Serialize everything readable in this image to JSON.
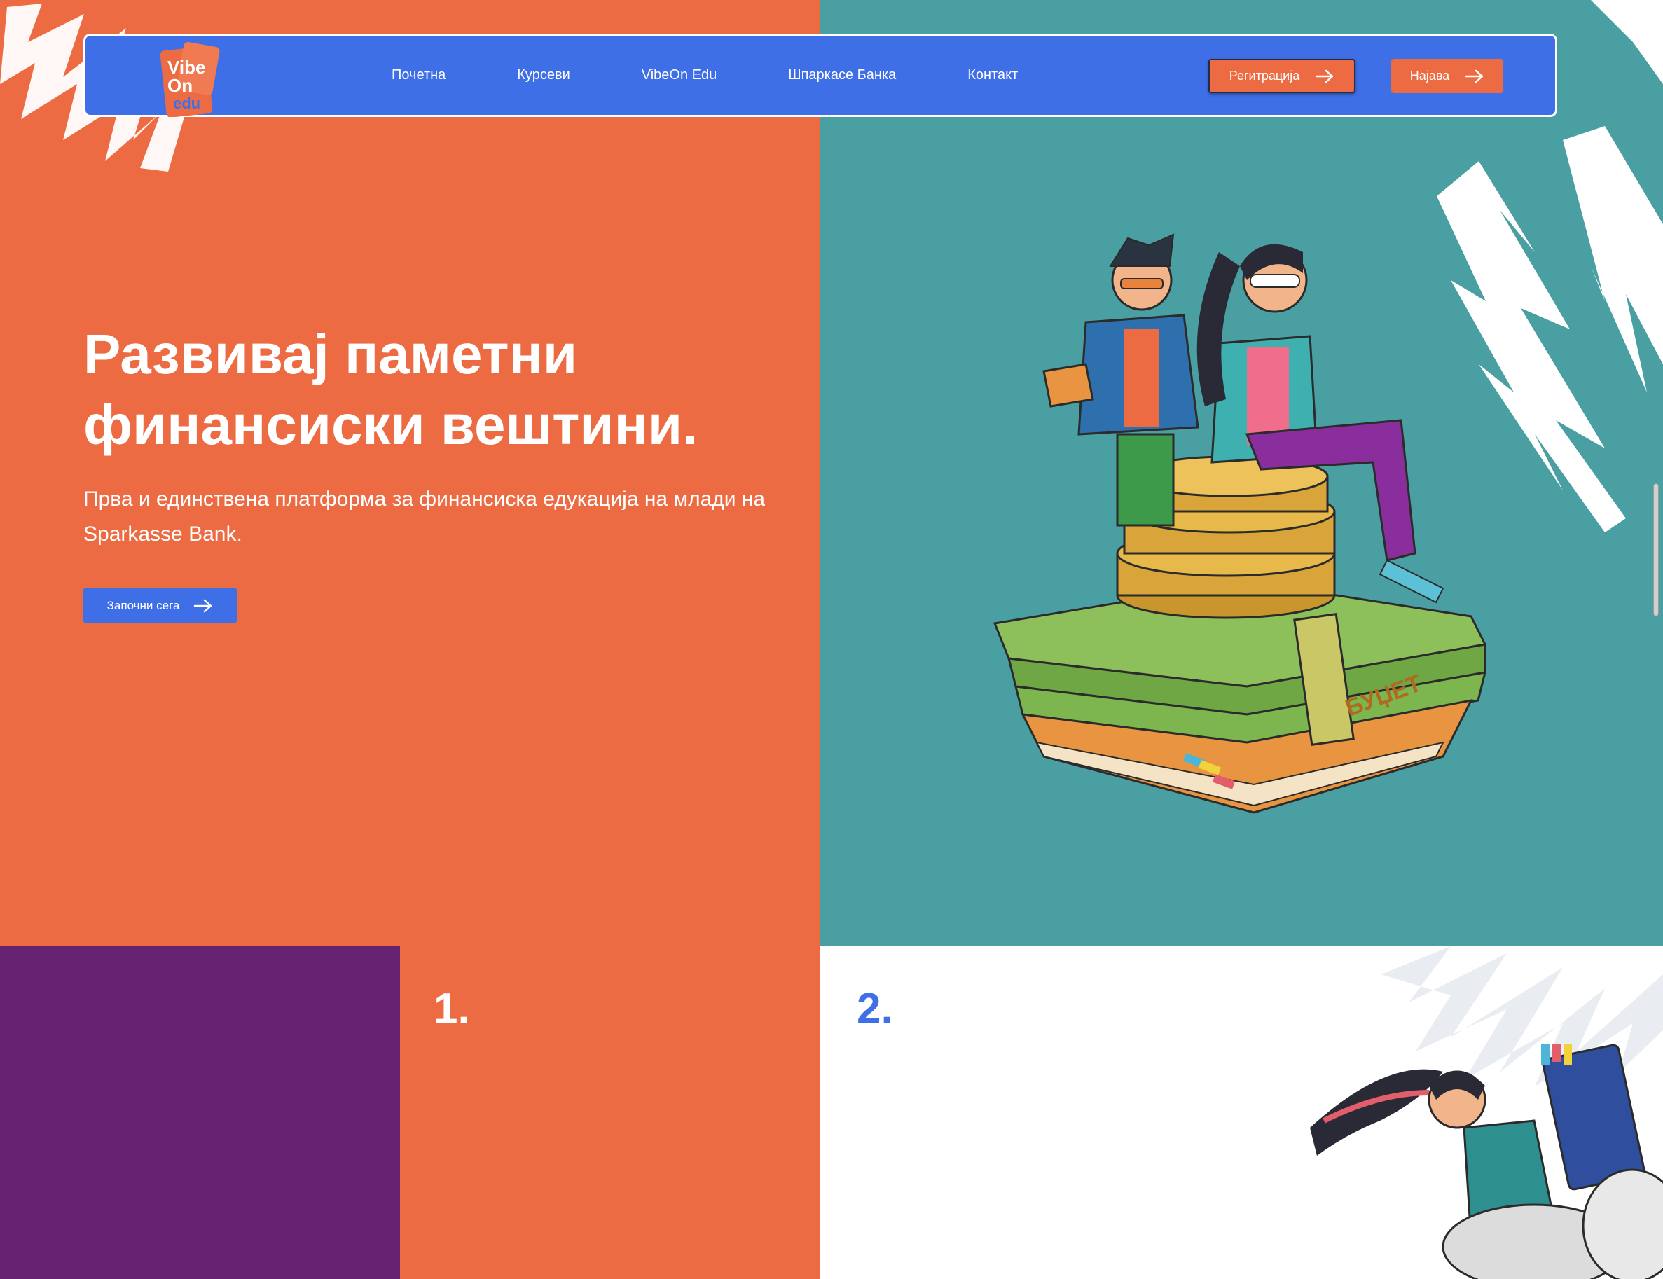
{
  "colors": {
    "orange": "#EC6B42",
    "teal": "#4A9FA3",
    "blue": "#3F6FE6",
    "purple": "#662372",
    "white": "#ffffff"
  },
  "logo": {
    "line1": "Vibe",
    "line2": "On",
    "line3": "edu"
  },
  "nav": {
    "items": [
      {
        "label": "Почетна"
      },
      {
        "label": "Курсеви"
      },
      {
        "label": "VibeOn Edu"
      },
      {
        "label": "Шпаркасе Банка"
      },
      {
        "label": "Контакт"
      }
    ],
    "register_label": "Регитрација",
    "login_label": "Најава",
    "arrow_icon": "arrow-right-icon"
  },
  "hero": {
    "title_line1": "Развивај паметни",
    "title_line2": "финансиски вештини.",
    "subtitle_line1": "Прва и единствена платформа за финансиска едукација на млади на",
    "subtitle_line2": "Sparkasse Bank.",
    "cta_label": "Започни сега",
    "book_label": "БУЏЕТ"
  },
  "steps": {
    "step1": "1.",
    "step2": "2."
  }
}
